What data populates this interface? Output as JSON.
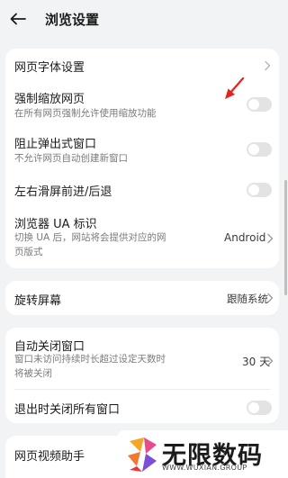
{
  "header": {
    "title": "浏览设置"
  },
  "card1": {
    "font_setting": "网页字体设置",
    "force_zoom": {
      "title": "强制缩放网页",
      "subtitle": "在所有网页强制允许使用缩放功能",
      "enabled": false
    },
    "block_popup": {
      "title": "阻止弹出式窗口",
      "subtitle": "不允许网页自动创建新窗口",
      "enabled": false
    },
    "swipe_nav": {
      "title": "左右滑屏前进/后退",
      "enabled": false
    },
    "ua": {
      "title": "浏览器 UA 标识",
      "subtitle_line1": "切换 UA 后，网站将会提供对应的网",
      "subtitle_line2": "页版式",
      "value": "Android"
    }
  },
  "card2": {
    "rotate": {
      "title": "旋转屏幕",
      "value": "跟随系统"
    }
  },
  "card3": {
    "auto_close": {
      "title": "自动关闭窗口",
      "subtitle_line1": "窗口未访问持续时长超过设定天数时",
      "subtitle_line2": "将被关闭",
      "value": "30 天"
    },
    "close_on_exit": {
      "title": "退出时关闭所有窗口",
      "enabled": false
    }
  },
  "card4": {
    "video_helper": "网页视频助手"
  },
  "watermark": {
    "name": "无限数码",
    "url": "WWW.WUXIAN.GROUP"
  },
  "colors": {
    "annotation_arrow": "#e8221b",
    "toggle_off": "#e3e3e3"
  }
}
